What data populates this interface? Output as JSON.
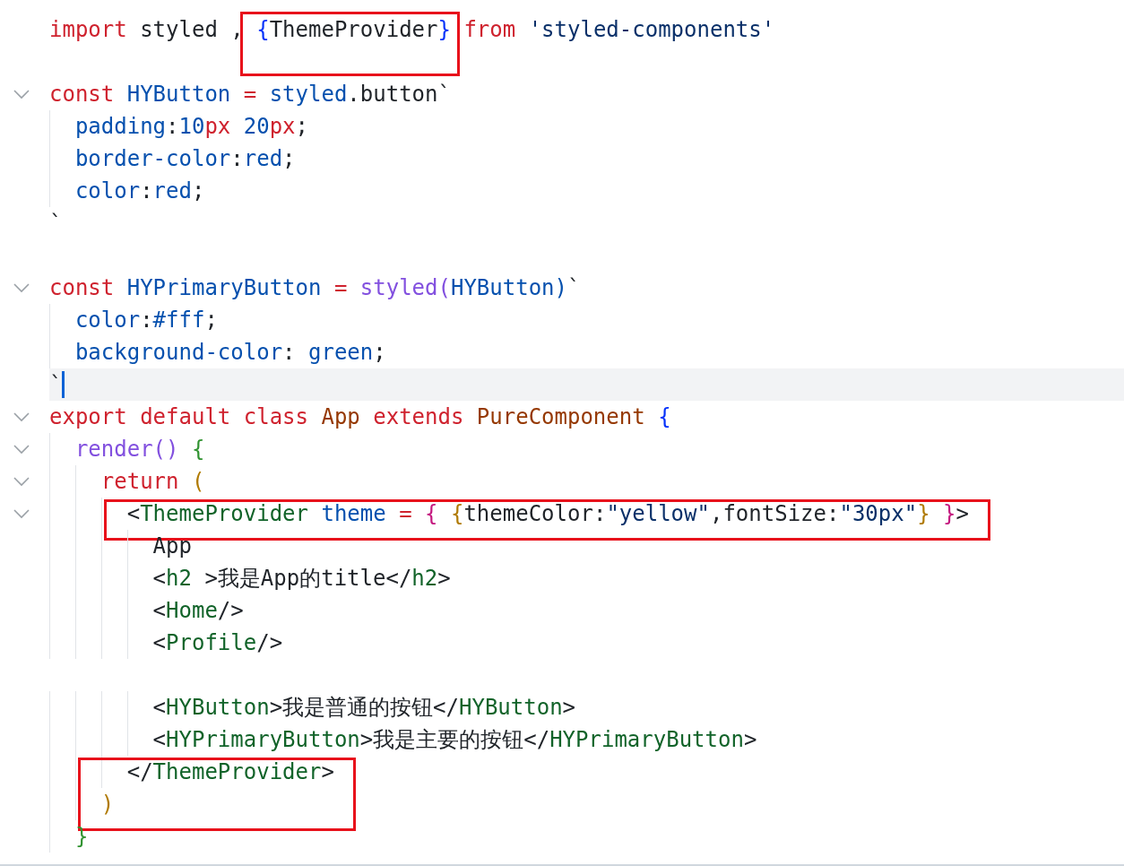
{
  "editor": {
    "lines": [
      {
        "fold": false,
        "tokens": [
          {
            "text": "import ",
            "kind": "kw"
          },
          {
            "text": "styled , ",
            "kind": "plain"
          },
          {
            "boxed": true,
            "tokens": [
              {
                "text": "{",
                "kind": "b1"
              },
              {
                "text": "ThemeProvider",
                "kind": "plain"
              },
              {
                "text": "} ",
                "kind": "b1"
              }
            ]
          },
          {
            "text": "from ",
            "kind": "kw"
          },
          {
            "text": "'styled-components'",
            "kind": "str"
          }
        ]
      },
      {
        "fold": false
      },
      {
        "fold": true,
        "tokens": [
          {
            "text": "const ",
            "kind": "kw"
          },
          {
            "text": "HYButton ",
            "kind": "prop"
          },
          {
            "text": "= ",
            "kind": "kw"
          },
          {
            "text": "styled",
            "kind": "prop"
          },
          {
            "text": ".button`",
            "kind": "plain"
          }
        ]
      },
      {
        "fold": false,
        "tokens": [
          {
            "text": "  padding",
            "kind": "prop"
          },
          {
            "text": ":",
            "kind": "plain"
          },
          {
            "text": "10",
            "kind": "prop"
          },
          {
            "text": "px ",
            "kind": "unit"
          },
          {
            "text": "20",
            "kind": "prop"
          },
          {
            "text": "px",
            "kind": "unit"
          },
          {
            "text": ";",
            "kind": "plain"
          }
        ]
      },
      {
        "fold": false,
        "tokens": [
          {
            "text": "  border-color",
            "kind": "prop"
          },
          {
            "text": ":",
            "kind": "plain"
          },
          {
            "text": "red",
            "kind": "prop"
          },
          {
            "text": ";",
            "kind": "plain"
          }
        ]
      },
      {
        "fold": false,
        "tokens": [
          {
            "text": "  color",
            "kind": "prop"
          },
          {
            "text": ":",
            "kind": "plain"
          },
          {
            "text": "red",
            "kind": "prop"
          },
          {
            "text": ";",
            "kind": "plain"
          }
        ]
      },
      {
        "fold": false,
        "tokens": [
          {
            "text": "`",
            "kind": "plain"
          }
        ]
      },
      {
        "fold": false
      },
      {
        "fold": true,
        "tokens": [
          {
            "text": "const ",
            "kind": "kw"
          },
          {
            "text": "HYPrimaryButton ",
            "kind": "prop"
          },
          {
            "text": "= ",
            "kind": "kw"
          },
          {
            "text": "styled(",
            "kind": "fn"
          },
          {
            "text": "HYButton)",
            "kind": "prop"
          },
          {
            "text": "`",
            "kind": "plain"
          }
        ]
      },
      {
        "fold": false,
        "tokens": [
          {
            "text": "  color",
            "kind": "prop"
          },
          {
            "text": ":",
            "kind": "plain"
          },
          {
            "text": "#fff",
            "kind": "prop"
          },
          {
            "text": ";",
            "kind": "plain"
          }
        ]
      },
      {
        "fold": false,
        "tokens": [
          {
            "text": "  background-color",
            "kind": "prop"
          },
          {
            "text": ": ",
            "kind": "plain"
          },
          {
            "text": "green",
            "kind": "prop"
          },
          {
            "text": ";",
            "kind": "plain"
          }
        ]
      },
      {
        "fold": false,
        "current": true,
        "tokens": [
          {
            "text": "`",
            "kind": "plain"
          }
        ]
      },
      {
        "fold": true,
        "tokens": [
          {
            "text": "export default class ",
            "kind": "kw"
          },
          {
            "text": "App ",
            "kind": "type"
          },
          {
            "text": "extends ",
            "kind": "kw"
          },
          {
            "text": "PureComponent ",
            "kind": "type"
          },
          {
            "text": "{",
            "kind": "b1"
          }
        ]
      },
      {
        "fold": true,
        "tokens": [
          {
            "text": "  render() ",
            "kind": "fn"
          },
          {
            "text": "{",
            "kind": "b2"
          }
        ]
      },
      {
        "fold": true,
        "tokens": [
          {
            "text": "    return ",
            "kind": "kw"
          },
          {
            "text": "(",
            "kind": "b3"
          }
        ]
      },
      {
        "fold": true,
        "boxed": true,
        "tokens": [
          {
            "text": "      <",
            "kind": "plain"
          },
          {
            "text": "ThemeProvider ",
            "kind": "tag"
          },
          {
            "text": "theme ",
            "kind": "prop"
          },
          {
            "text": "= ",
            "kind": "kw"
          },
          {
            "text": "{ ",
            "kind": "b4"
          },
          {
            "text": "{",
            "kind": "b3"
          },
          {
            "text": "themeColor:",
            "kind": "plain"
          },
          {
            "text": "\"yellow\"",
            "kind": "str"
          },
          {
            "text": ",fontSize:",
            "kind": "plain"
          },
          {
            "text": "\"30px\"",
            "kind": "str"
          },
          {
            "text": "} ",
            "kind": "b3"
          },
          {
            "text": "}",
            "kind": "b4"
          },
          {
            "text": ">",
            "kind": "plain"
          }
        ]
      },
      {
        "fold": false,
        "tokens": [
          {
            "text": "        App",
            "kind": "plain"
          }
        ]
      },
      {
        "fold": false,
        "tokens": [
          {
            "text": "        <",
            "kind": "plain"
          },
          {
            "text": "h2",
            "kind": "tag"
          },
          {
            "text": " >我是App的title</",
            "kind": "plain"
          },
          {
            "text": "h2",
            "kind": "tag"
          },
          {
            "text": ">",
            "kind": "plain"
          }
        ]
      },
      {
        "fold": false,
        "tokens": [
          {
            "text": "        <",
            "kind": "plain"
          },
          {
            "text": "Home",
            "kind": "tag"
          },
          {
            "text": "/>",
            "kind": "plain"
          }
        ]
      },
      {
        "fold": false,
        "tokens": [
          {
            "text": "        <",
            "kind": "plain"
          },
          {
            "text": "Profile",
            "kind": "tag"
          },
          {
            "text": "/>",
            "kind": "plain"
          }
        ]
      },
      {
        "fold": false
      },
      {
        "fold": false,
        "tokens": [
          {
            "text": "        <",
            "kind": "plain"
          },
          {
            "text": "HYButton",
            "kind": "tag"
          },
          {
            "text": ">我是普通的按钮</",
            "kind": "plain"
          },
          {
            "text": "HYButton",
            "kind": "tag"
          },
          {
            "text": ">",
            "kind": "plain"
          }
        ]
      },
      {
        "fold": false,
        "tokens": [
          {
            "text": "        <",
            "kind": "plain"
          },
          {
            "text": "HYPrimaryButton",
            "kind": "tag"
          },
          {
            "text": ">我是主要的按钮</",
            "kind": "plain"
          },
          {
            "text": "HYPrimaryButton",
            "kind": "tag"
          },
          {
            "text": ">",
            "kind": "plain"
          }
        ]
      },
      {
        "fold": false,
        "boxed": true,
        "tokens": [
          {
            "text": "      </",
            "kind": "plain"
          },
          {
            "text": "ThemeProvider",
            "kind": "tag"
          },
          {
            "text": ">",
            "kind": "plain"
          }
        ]
      },
      {
        "fold": false,
        "boxed": true,
        "tokens": [
          {
            "text": "    )",
            "kind": "b3"
          }
        ]
      },
      {
        "fold": false,
        "tokens": [
          {
            "text": "  }",
            "kind": "b2"
          }
        ]
      }
    ]
  }
}
